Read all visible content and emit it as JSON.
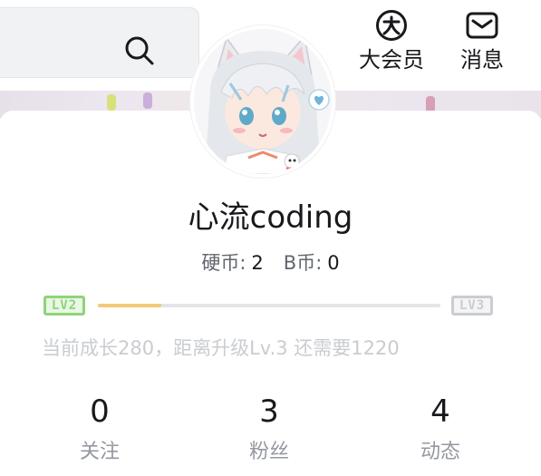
{
  "header": {
    "search": {
      "icon": "search-icon"
    },
    "nav": [
      {
        "label": "大会员",
        "icon": "vip-circle-icon"
      },
      {
        "label": "消息",
        "icon": "mail-icon"
      }
    ]
  },
  "profile": {
    "avatar": "anime-character-avatar",
    "username": "心流coding",
    "coins": {
      "hard_label": "硬币:",
      "hard_value": "2",
      "b_label": "B币:",
      "b_value": "0"
    },
    "level": {
      "current": "LV2",
      "next": "LV3",
      "progress": 0.186,
      "text": "当前成长280，距离升级Lv.3 还需要1220"
    },
    "stats": [
      {
        "value": "0",
        "label": "关注"
      },
      {
        "value": "3",
        "label": "粉丝"
      },
      {
        "value": "4",
        "label": "动态"
      }
    ]
  },
  "colors": {
    "level_current": "#8ed47a",
    "level_next": "#c9ccd0",
    "progress_fill": "#f3c97a",
    "progress_track": "#e3e5e7",
    "muted_text": "#9499a0"
  }
}
